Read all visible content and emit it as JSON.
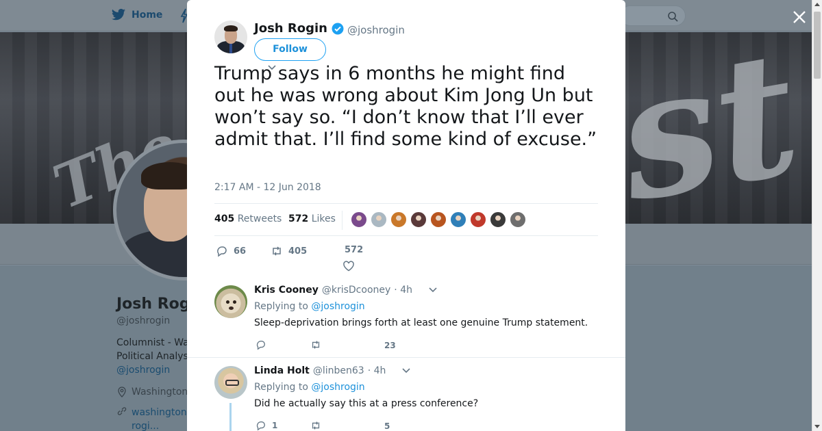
{
  "nav": {
    "home_label": "Home"
  },
  "background_profile": {
    "name": "Josh Rog",
    "handle": "@joshrogin",
    "bio_line1": "Columnist - Wa",
    "bio_line2": "Political Analys",
    "bio_mention": "@joshrogin",
    "location": "Washington",
    "link_line1": "washington",
    "link_line2": "rogi..."
  },
  "tweet": {
    "author_name": "Josh Rogin",
    "author_handle": "@joshrogin",
    "follow_label": "Follow",
    "text": "Trump says in 6 months he might find out he was wrong about Kim Jong Un but won’t say so. “I don’t know that I’ll ever admit that. I’ll find some kind of excuse.”",
    "timestamp": "2:17 AM - 12 Jun 2018",
    "retweets_count": "405",
    "retweets_label": "Retweets",
    "likes_count": "572",
    "likes_label": "Likes",
    "likers_colors": [
      "#7a4a8c",
      "#aab8c2",
      "#c9782a",
      "#5a3a3a",
      "#b8551f",
      "#2f7fb8",
      "#c0392b",
      "#3a3a3a",
      "#6e6e6e"
    ],
    "actions": {
      "replies": "66",
      "retweets": "405",
      "likes": "572"
    }
  },
  "replies": [
    {
      "name": "Kris Cooney",
      "handle": "@krisDcooney",
      "time": "· 4h",
      "replying_prefix": "Replying to",
      "replying_to": "@joshrogin",
      "text": "Sleep-deprivation brings forth at least one genuine Trump statement.",
      "reply_count": "",
      "retweet_count": "",
      "like_count": "23"
    },
    {
      "name": "Linda Holt",
      "handle": "@linben63",
      "time": "· 4h",
      "replying_prefix": "Replying to",
      "replying_to": "@joshrogin",
      "text": "Did he actually say this at a press conference?",
      "reply_count": "1",
      "retweet_count": "",
      "like_count": "5"
    }
  ],
  "colors": {
    "accent": "#1da1f2",
    "link": "#1d91da",
    "muted": "#657786",
    "verified": "#1da1f2"
  }
}
